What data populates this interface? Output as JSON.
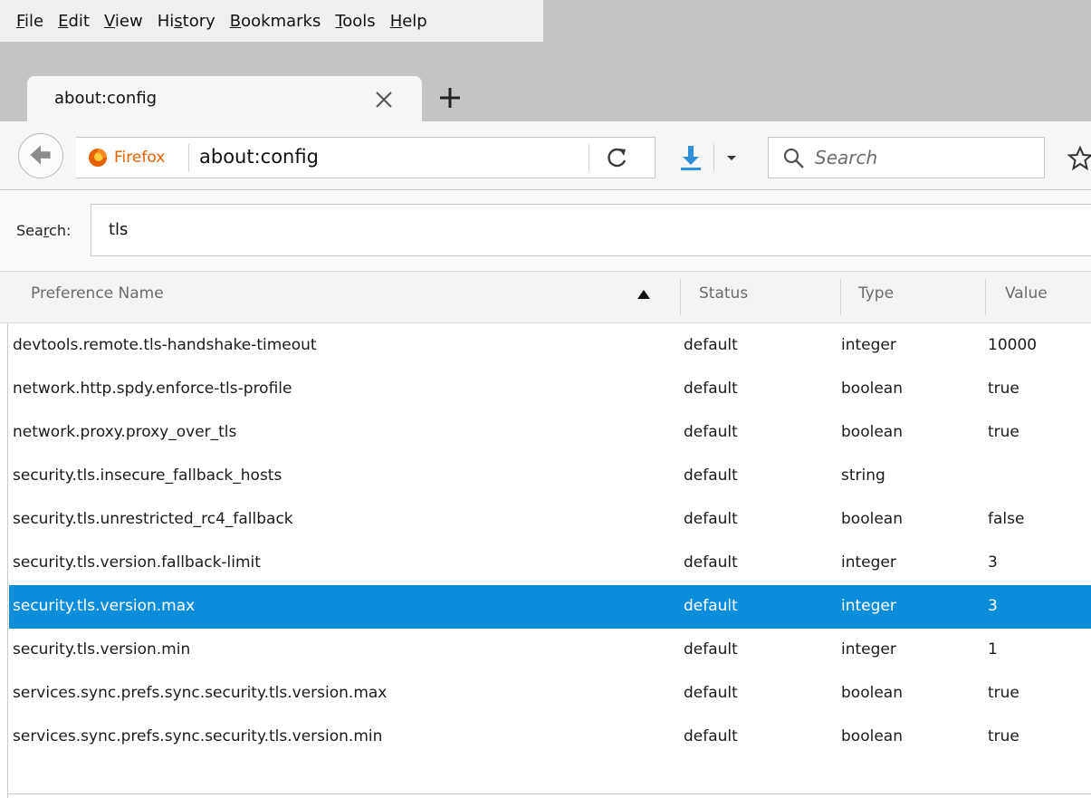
{
  "menu": [
    {
      "pre": "",
      "key": "F",
      "post": "ile"
    },
    {
      "pre": "",
      "key": "E",
      "post": "dit"
    },
    {
      "pre": "",
      "key": "V",
      "post": "iew"
    },
    {
      "pre": "Hi",
      "key": "s",
      "post": "tory"
    },
    {
      "pre": "",
      "key": "B",
      "post": "ookmarks"
    },
    {
      "pre": "",
      "key": "T",
      "post": "ools"
    },
    {
      "pre": "",
      "key": "H",
      "post": "elp"
    }
  ],
  "tab": {
    "title": "about:config"
  },
  "navbar": {
    "identity_label": "Firefox",
    "url": "about:config",
    "search_placeholder": "Search"
  },
  "config_search": {
    "label_pre": "Sea",
    "label_key": "r",
    "label_post": "ch:",
    "value": "tls"
  },
  "table": {
    "headers": {
      "name": "Preference Name",
      "status": "Status",
      "type": "Type",
      "value": "Value"
    },
    "rows": [
      {
        "name": "devtools.remote.tls-handshake-timeout",
        "status": "default",
        "type": "integer",
        "value": "10000"
      },
      {
        "name": "network.http.spdy.enforce-tls-profile",
        "status": "default",
        "type": "boolean",
        "value": "true"
      },
      {
        "name": "network.proxy.proxy_over_tls",
        "status": "default",
        "type": "boolean",
        "value": "true"
      },
      {
        "name": "security.tls.insecure_fallback_hosts",
        "status": "default",
        "type": "string",
        "value": ""
      },
      {
        "name": "security.tls.unrestricted_rc4_fallback",
        "status": "default",
        "type": "boolean",
        "value": "false"
      },
      {
        "name": "security.tls.version.fallback-limit",
        "status": "default",
        "type": "integer",
        "value": "3"
      },
      {
        "name": "security.tls.version.max",
        "status": "default",
        "type": "integer",
        "value": "3",
        "selected": true
      },
      {
        "name": "security.tls.version.min",
        "status": "default",
        "type": "integer",
        "value": "1"
      },
      {
        "name": "services.sync.prefs.sync.security.tls.version.max",
        "status": "default",
        "type": "boolean",
        "value": "true"
      },
      {
        "name": "services.sync.prefs.sync.security.tls.version.min",
        "status": "default",
        "type": "boolean",
        "value": "true"
      }
    ]
  },
  "colors": {
    "selection": "#0a8ddb",
    "firefox_brand": "#e66000",
    "download_accent": "#2f8fd8"
  },
  "icons": {
    "back": "arrow-left-icon",
    "identity": "firefox-logo-icon",
    "reload": "reload-icon",
    "download": "download-icon",
    "search": "magnifier-icon",
    "bookmark": "star-icon",
    "close": "close-icon",
    "new_tab": "plus-icon",
    "sort": "sort-ascending-icon"
  }
}
